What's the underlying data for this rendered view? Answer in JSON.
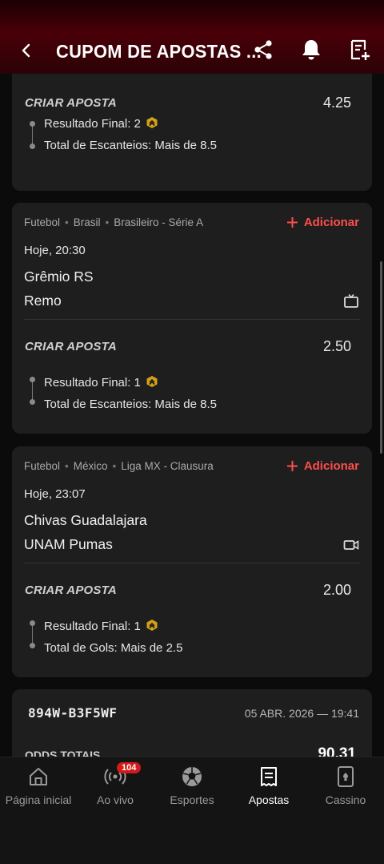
{
  "header": {
    "title": "CUPOM DE APOSTAS ...",
    "back_icon": "chevron-left-icon",
    "share_icon": "share-icon",
    "bell_icon": "bell-icon",
    "add_bet_icon": "add-slip-icon"
  },
  "colors": {
    "accent": "#ff4d4d",
    "card_bg": "#1e1e1e",
    "header_red": "#4a0008",
    "badge_gold": "#d4a017"
  },
  "cards": [
    {
      "criar_label": "CRIAR APOSTA",
      "odds": "4.25",
      "selections": [
        "Resultado Final: 2",
        "Total de Escanteios: Mais de 8.5"
      ]
    },
    {
      "sport": "Futebol",
      "country": "Brasil",
      "league": "Brasileiro - Série A",
      "add_label": "Adicionar",
      "datetime": "Hoje, 20:30",
      "home": "Grêmio RS",
      "away": "Remo",
      "media_icon": "tv-icon",
      "criar_label": "CRIAR APOSTA",
      "odds": "2.50",
      "selections": [
        "Resultado Final: 1",
        "Total de Escanteios: Mais de 8.5"
      ]
    },
    {
      "sport": "Futebol",
      "country": "México",
      "league": "Liga MX - Clausura",
      "add_label": "Adicionar",
      "datetime": "Hoje, 23:07",
      "home": "Chivas Guadalajara",
      "away": "UNAM Pumas",
      "media_icon": "video-icon",
      "criar_label": "CRIAR APOSTA",
      "odds": "2.00",
      "selections": [
        "Resultado Final: 1",
        "Total de Gols: Mais de 2.5"
      ]
    }
  ],
  "summary": {
    "code": "894W-B3F5WF",
    "date": "05 ABR. 2026 — 19:41",
    "odds_label": "ODDS TOTAIS",
    "odds_value": "90.31"
  },
  "nav": [
    {
      "label": "Página inicial",
      "icon": "home-icon"
    },
    {
      "label": "Ao vivo",
      "icon": "live-icon",
      "badge": "104"
    },
    {
      "label": "Esportes",
      "icon": "soccer-ball-icon"
    },
    {
      "label": "Apostas",
      "icon": "bets-icon",
      "active": true
    },
    {
      "label": "Cassino",
      "icon": "cards-icon"
    }
  ]
}
